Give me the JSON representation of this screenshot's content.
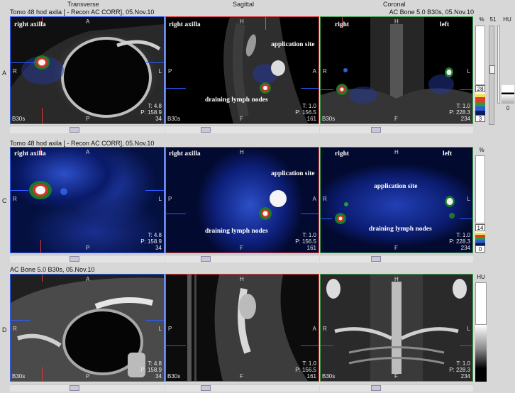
{
  "columns": [
    "Transverse",
    "Sagittal",
    "Coronal"
  ],
  "rows": [
    {
      "letter": "A",
      "title": "Tomo 48 hod axila [ - Recon AC CORR], 05.Nov.10",
      "title_right": "AC  Bone  5.0  B30s, 05.Nov.10",
      "panels": [
        {
          "labels": [
            "right axilla"
          ],
          "ori": {
            "top": "A",
            "bottom": "P",
            "left": "R",
            "right": "L"
          },
          "info": [
            "T: 4.8",
            "P: 158.9",
            "34"
          ],
          "kernel": "B30s"
        },
        {
          "labels": [
            "right axilla",
            "application site",
            "draining lymph nodes"
          ],
          "ori": {
            "top": "H",
            "bottom": "F",
            "left": "P",
            "right": "A"
          },
          "info": [
            "T: 1.0",
            "P: 156.5",
            "161"
          ],
          "kernel": "B30s"
        },
        {
          "labels": [
            "right",
            "left"
          ],
          "ori": {
            "top": "H",
            "bottom": "F",
            "left": "R",
            "right": "L"
          },
          "info": [
            "T: 1.0",
            "P: 228.3",
            "234"
          ],
          "kernel": "B30s"
        }
      ]
    },
    {
      "letter": "C",
      "title": "Tomo 48 hod axila [ - Recon AC CORR], 05.Nov.10",
      "panels": [
        {
          "labels": [
            "right axilla"
          ],
          "ori": {
            "top": "A",
            "bottom": "P",
            "left": "R",
            "right": "L"
          },
          "info": [
            "T: 4.8",
            "P: 158.9",
            "34"
          ]
        },
        {
          "labels": [
            "right axilla",
            "application site",
            "draining lymph nodes"
          ],
          "ori": {
            "top": "H",
            "bottom": "F",
            "left": "P",
            "right": "A"
          },
          "info": [
            "T: 1.0",
            "P: 156.5",
            "161"
          ]
        },
        {
          "labels": [
            "right",
            "left",
            "application site",
            "draining lymph nodes"
          ],
          "ori": {
            "top": "H",
            "bottom": "F",
            "left": "R",
            "right": "L"
          },
          "info": [
            "T: 1.0",
            "P: 228.3",
            "234"
          ]
        }
      ]
    },
    {
      "letter": "D",
      "title": "AC  Bone  5.0  B30s, 05.Nov.10",
      "panels": [
        {
          "ori": {
            "top": "A",
            "bottom": "P",
            "left": "R",
            "right": "L"
          },
          "info": [
            "T: 4.8",
            "P: 158.9",
            "34"
          ],
          "kernel": "B30s"
        },
        {
          "ori": {
            "top": "H",
            "bottom": "F",
            "left": "P",
            "right": "A"
          },
          "info": [
            "T: 1.0",
            "P: 156.5",
            "161"
          ],
          "kernel": "B30s"
        },
        {
          "ori": {
            "top": "H",
            "bottom": "F",
            "left": "R",
            "right": "L"
          },
          "info": [
            "T: 1.0",
            "P: 228.3",
            "234"
          ],
          "kernel": "B30s"
        }
      ]
    }
  ],
  "colorbar_top": {
    "unit_pct": "%",
    "unit_hu": "HU",
    "max_pct": "51",
    "value_upper": "28",
    "value_lower": "3",
    "hu_value": "0"
  },
  "colorbar_mid": {
    "unit_pct": "%",
    "value_upper": "14",
    "value_lower": "0"
  },
  "colorbar_bottom": {
    "unit_hu": "HU"
  },
  "colors": {
    "transverse_frame": "#2a5cff",
    "sagittal_frame": "#e0393b",
    "coronal_frame": "#3ba34a"
  }
}
